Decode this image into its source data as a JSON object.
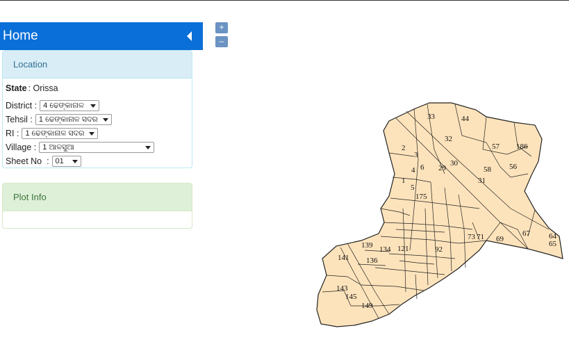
{
  "sidebar": {
    "title": "Home"
  },
  "zoom": {
    "in": "+",
    "out": "–"
  },
  "location": {
    "heading": "Location",
    "state_label": "State",
    "state_value": ": Orissa",
    "district_label": "District :",
    "district_value": "4 ଢେଙ୍କାନାଳ",
    "tehsil_label": "Tehsil :",
    "tehsil_value": "1 ଢେଙ୍କାନାଳ ସଦର",
    "ri_label": "RI :",
    "ri_value": "1 ଢେଙ୍କାନାଳ ସଦର",
    "village_label": "Village :",
    "village_value": "1 ଆଳସୁଆ",
    "sheet_label": "Sheet No  :",
    "sheet_value": "01"
  },
  "plot_info": {
    "heading": "Plot Info"
  },
  "map": {
    "fill_color": "#fde3bb",
    "plot_numbers": [
      "33",
      "44",
      "32",
      "57",
      "186",
      "2",
      "3",
      "29",
      "30",
      "58",
      "56",
      "4",
      "6",
      "1",
      "5",
      "31",
      "175",
      "67",
      "69",
      "73",
      "71",
      "64",
      "65",
      "139",
      "134",
      "121",
      "92",
      "141",
      "136",
      "143",
      "145",
      "149"
    ]
  }
}
